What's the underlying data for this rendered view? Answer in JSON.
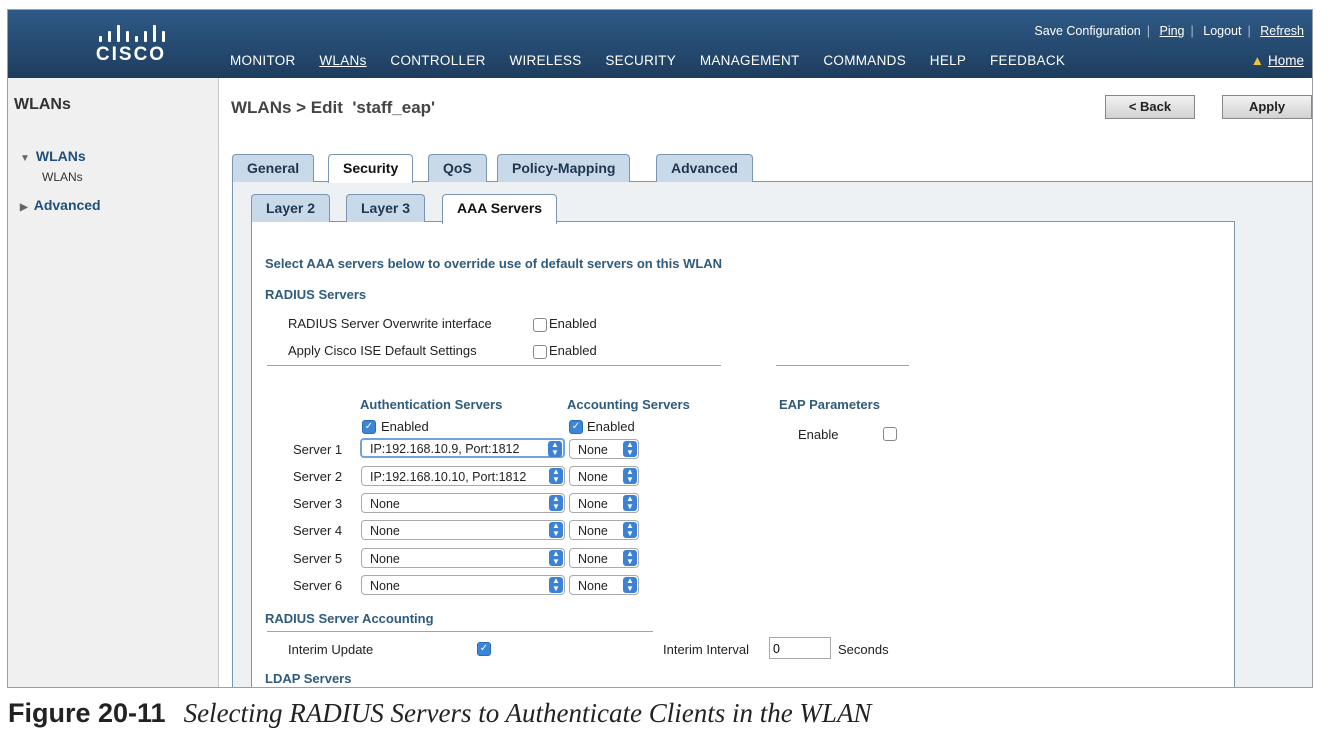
{
  "header": {
    "logo_text": "CISCO",
    "top_links": [
      "Save Configuration",
      "Ping",
      "Logout",
      "Refresh"
    ],
    "nav": [
      "MONITOR",
      "WLANs",
      "CONTROLLER",
      "WIRELESS",
      "SECURITY",
      "MANAGEMENT",
      "COMMANDS",
      "HELP",
      "FEEDBACK"
    ],
    "home_label": "Home"
  },
  "sidebar": {
    "title": "WLANs",
    "items": [
      {
        "label": "WLANs",
        "sub": "WLANs"
      },
      {
        "label": "Advanced"
      }
    ]
  },
  "page": {
    "title": "WLANs > Edit  'staff_eap'",
    "back_label": "< Back",
    "apply_label": "Apply"
  },
  "tabs": [
    "General",
    "Security",
    "QoS",
    "Policy-Mapping",
    "Advanced"
  ],
  "subtabs": [
    "Layer 2",
    "Layer 3",
    "AAA Servers"
  ],
  "aaa": {
    "intro": "Select AAA servers below to override use of default servers on this WLAN",
    "radius_title": "RADIUS Servers",
    "overwrite_label": "RADIUS Server Overwrite interface",
    "ise_label": "Apply Cisco ISE Default Settings",
    "enabled_label": "Enabled",
    "auth_header": "Authentication Servers",
    "acct_header": "Accounting Servers",
    "eap_header": "EAP Parameters",
    "eap_enable_label": "Enable",
    "servers": [
      {
        "label": "Server 1",
        "auth": "IP:192.168.10.9, Port:1812",
        "acct": "None"
      },
      {
        "label": "Server 2",
        "auth": "IP:192.168.10.10, Port:1812",
        "acct": "None"
      },
      {
        "label": "Server 3",
        "auth": "None",
        "acct": "None"
      },
      {
        "label": "Server 4",
        "auth": "None",
        "acct": "None"
      },
      {
        "label": "Server 5",
        "auth": "None",
        "acct": "None"
      },
      {
        "label": "Server 6",
        "auth": "None",
        "acct": "None"
      }
    ],
    "accounting_title": "RADIUS Server Accounting",
    "interim_update_label": "Interim Update",
    "interim_interval_label": "Interim Interval",
    "interim_interval_value": "0",
    "seconds_label": "Seconds",
    "ldap_title": "LDAP Servers"
  },
  "caption": {
    "figure": "Figure 20-11",
    "text": "Selecting RADIUS Servers to Authenticate Clients in the WLAN"
  },
  "colors": {
    "header_bg": "#1e3d5e",
    "tab_bg": "#c8d9ea",
    "accent": "#3b86d8"
  }
}
